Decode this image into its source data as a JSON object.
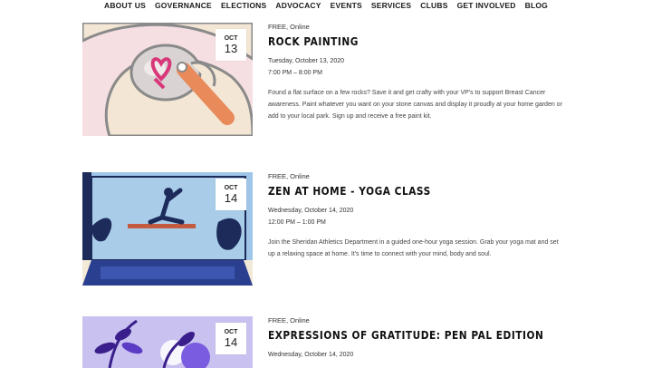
{
  "nav": {
    "items": [
      "ABOUT US",
      "GOVERNANCE",
      "ELECTIONS",
      "ADVOCACY",
      "EVENTS",
      "SERVICES",
      "CLUBS",
      "GET INVOLVED",
      "BLOG"
    ]
  },
  "events": [
    {
      "month": "OCT",
      "day": "13",
      "meta": "FREE, Online",
      "title": "Rock Painting",
      "date": "Tuesday, October 13, 2020",
      "time": "7:00 PM – 8:00 PM",
      "description": "Found a flat surface on a few rocks? Save it and get crafty with your VP's to support Breast Cancer awareness. Paint whatever you want on your stone canvas and display it proudly at your home garden or add to your local park. Sign up and receive a free paint kit."
    },
    {
      "month": "OCT",
      "day": "14",
      "meta": "FREE, Online",
      "title": "Zen at Home - Yoga Class",
      "date": "Wednesday, October 14, 2020",
      "time": "12:00 PM – 1:00 PM",
      "description": "Join the Sheridan Athletics Department in a guided one-hour yoga session. Grab your yoga mat and set up a relaxing space at home. It's time to connect with your mind, body and soul."
    },
    {
      "month": "OCT",
      "day": "14",
      "meta": "FREE, Online",
      "title": "Expressions of Gratitude: Pen Pal Edition",
      "date": "Wednesday, October 14, 2020"
    }
  ],
  "colors": {
    "rock_bg": "#f6dfe2",
    "yoga_bg": "#9fc6e8",
    "gratitude_bg": "#c9c2f0"
  }
}
